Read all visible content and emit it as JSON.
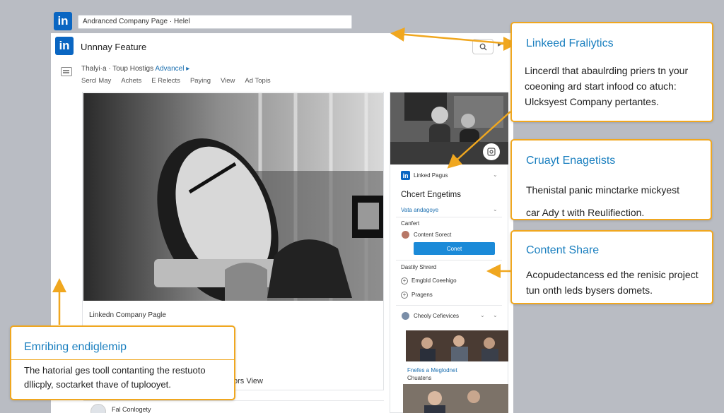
{
  "topbar": {
    "search_value": "Andranced Company Page · Helel",
    "logo": "in"
  },
  "window": {
    "logo": "in",
    "title": "Unnnay Feature",
    "breadcrumb": {
      "text": "Thalyi·a · Toup Hostigs",
      "advanced": "Advancel ▸"
    },
    "nav": [
      "Sercl May",
      "Achets",
      "E Relects",
      "Paying",
      "View",
      "Ad Topis"
    ],
    "search_icon": "search-icon"
  },
  "hero": {
    "caption": "Linkedn Company Pagle",
    "bottom_text": "ors View"
  },
  "right_panel": {
    "page_label": "Linked Pagus",
    "heading": "Chcert Engetims",
    "link": "Vata andagoye",
    "section1": "Canfert",
    "contact_label": "Content Sorect",
    "connect_button": "Conet",
    "shared_label": "Dastily Shrerd",
    "option1": "Emgbld Coeehigo",
    "option2": "Pragens",
    "coleves": "Cheoly Cefievices",
    "small_line1": "Fnefes a Meglodnet",
    "small_line2": "Chuatens",
    "icons": [
      "camera-icon",
      "linkedin-icon",
      "chevron-down-icon",
      "plus-icon"
    ]
  },
  "callouts": {
    "analytics": {
      "title": "Linkeed Fraliytics",
      "body": [
        "Lincerdl that abaulrding priers tn your",
        "coeoning ard start infood co atuch:",
        "Ulcksyest Company pertantes."
      ]
    },
    "engagement": {
      "title": "Cruayt Enagetists",
      "body": [
        "Thenistal panic minctarke mickyest",
        "car Ady t with Reulifiection."
      ]
    },
    "content_share": {
      "title": "Content Share",
      "body": [
        "Acopudectancess ed the renisic project",
        "tun onth leds bysers domets."
      ]
    },
    "employee": {
      "title": "Emribing endiglemip",
      "body": [
        "The hatorial ges tooll contanting the restuoto",
        "dllicply, soctarket thave of tuplooyet."
      ]
    }
  },
  "bottom": {
    "text": "Fal Conlogety"
  },
  "colors": {
    "accent": "#0a66c2",
    "callout_border": "#f0a71f",
    "callout_title": "#1a7fbf",
    "button": "#1b8ad8"
  }
}
